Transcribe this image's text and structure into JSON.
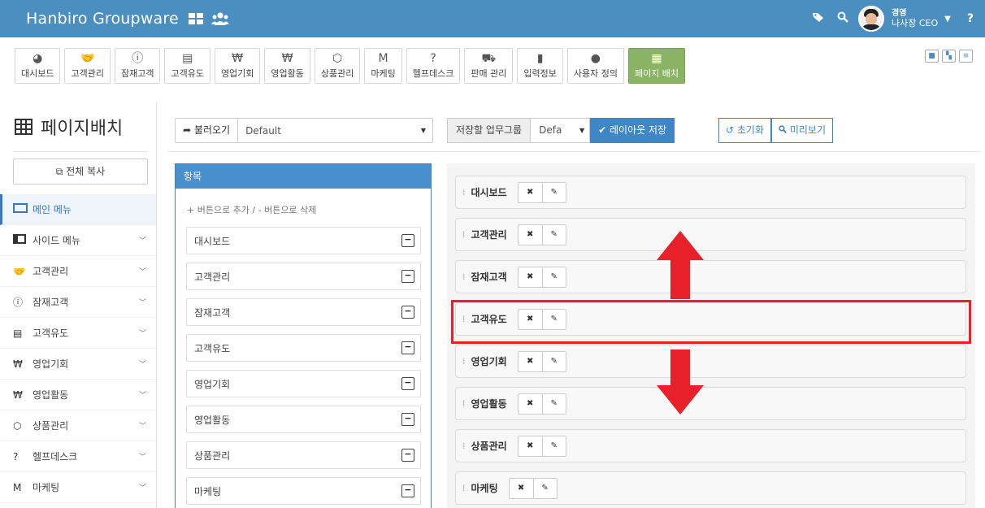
{
  "header": {
    "brand": "Hanbiro Groupware",
    "user_line1": "경영",
    "user_line2": "나사장 CEO",
    "help": "?"
  },
  "toolbar": {
    "items": [
      {
        "label": "대시보드",
        "icon": "pie-chart-icon",
        "glyph": "◕"
      },
      {
        "label": "고객관리",
        "icon": "handshake-icon",
        "glyph": "🤝"
      },
      {
        "label": "잠재고객",
        "icon": "info-icon",
        "glyph": "ⓘ"
      },
      {
        "label": "고객유도",
        "icon": "document-icon",
        "glyph": "▤"
      },
      {
        "label": "영업기회",
        "icon": "money-icon",
        "glyph": "₩"
      },
      {
        "label": "영업활동",
        "icon": "money-stack-icon",
        "glyph": "₩"
      },
      {
        "label": "상품관리",
        "icon": "cube-icon",
        "glyph": "⬡"
      },
      {
        "label": "마케팅",
        "icon": "marketing-icon",
        "glyph": "M"
      },
      {
        "label": "헬프데스크",
        "icon": "question-icon",
        "glyph": "?"
      },
      {
        "label": "판매 관리",
        "icon": "cart-icon",
        "glyph": "⛟"
      },
      {
        "label": "입력정보",
        "icon": "files-icon",
        "glyph": "▮"
      },
      {
        "label": "사용자 정의",
        "icon": "user-icon",
        "glyph": "●"
      },
      {
        "label": "페이지 배치",
        "icon": "grid-icon",
        "glyph": "▦",
        "active": true
      }
    ]
  },
  "sidebar": {
    "title": "페이지배치",
    "copy_button": "전체 복사",
    "items": [
      {
        "label": "메인 메뉴",
        "icon": "window-icon",
        "active": true
      },
      {
        "label": "사이드 메뉴",
        "icon": "sidebar-layout-icon",
        "chevron": true
      },
      {
        "label": "고객관리",
        "icon": "handshake-icon",
        "glyph": "🤝",
        "chevron": true
      },
      {
        "label": "잠재고객",
        "icon": "info-icon",
        "glyph": "ⓘ",
        "chevron": true
      },
      {
        "label": "고객유도",
        "icon": "document-icon",
        "glyph": "▤",
        "chevron": true
      },
      {
        "label": "영업기회",
        "icon": "money-icon",
        "glyph": "₩",
        "chevron": true
      },
      {
        "label": "영업활동",
        "icon": "money-stack-icon",
        "glyph": "₩",
        "chevron": true
      },
      {
        "label": "상품관리",
        "icon": "cube-icon",
        "glyph": "⬡",
        "chevron": true
      },
      {
        "label": "헬프데스크",
        "icon": "question-icon",
        "glyph": "?",
        "chevron": true
      },
      {
        "label": "마케팅",
        "icon": "marketing-icon",
        "glyph": "M",
        "chevron": true
      }
    ]
  },
  "controls": {
    "load_button": "불러오기",
    "load_select": "Default",
    "save_group_label": "저장할 업무그룹",
    "save_group_select": "Defa",
    "save_layout_button": "레이아웃 저장",
    "reset_button": "초기화",
    "preview_button": "미리보기"
  },
  "items_panel": {
    "title": "항목",
    "hint": "+ 버튼으로 추가 / - 버튼으로 삭제",
    "rows": [
      "대시보드",
      "고객관리",
      "잠재고객",
      "고객유도",
      "영업기회",
      "영업활동",
      "상품관리",
      "마케팅"
    ]
  },
  "layout_panel": {
    "rows": [
      "대시보드",
      "고객관리",
      "잠재고객",
      "고객유도",
      "영업기회",
      "영업활동",
      "상품관리",
      "마케팅"
    ],
    "highlighted": "고객유도"
  },
  "colors": {
    "topbar": "#4a8fc0",
    "accent": "#3f86c5",
    "active_toolbar": "#8ab363",
    "highlight": "#e8202a"
  }
}
